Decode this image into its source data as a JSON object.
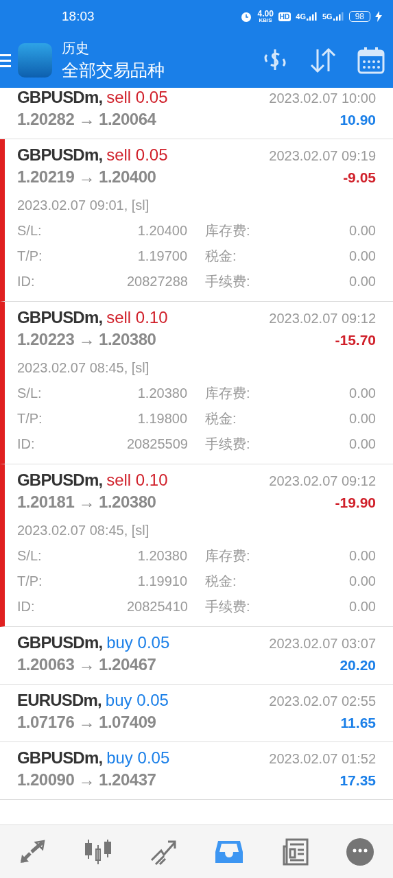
{
  "status_bar": {
    "time": "18:03",
    "speed": "4.00",
    "speed_unit": "KB/S",
    "hd": "HD",
    "net_1": "4G",
    "net_2": "5G",
    "battery": "98"
  },
  "header": {
    "title": "历史",
    "subtitle": "全部交易品种"
  },
  "trades": [
    {
      "symbol": "GBPUSDm,",
      "order": "sell 0.05",
      "kind": "sell",
      "prices": "1.20282 → 1.20064",
      "close_time": "2023.02.07 10:00",
      "profit": "10.90",
      "loss": false,
      "expanded": false
    },
    {
      "symbol": "GBPUSDm,",
      "order": "sell 0.05",
      "kind": "sell",
      "prices": "1.20219 → 1.20400",
      "close_time": "2023.02.07 09:19",
      "profit": "-9.05",
      "loss": true,
      "expanded": true,
      "open_time": "2023.02.07 09:01, [sl]",
      "details": [
        {
          "label": "S/L:",
          "value": "1.20400",
          "label_2": "库存费:",
          "value_2": "0.00"
        },
        {
          "label": "T/P:",
          "value": "1.19700",
          "label_2": "税金:",
          "value_2": "0.00"
        },
        {
          "label": "ID:",
          "value": "20827288",
          "label_2": "手续费:",
          "value_2": "0.00"
        }
      ]
    },
    {
      "symbol": "GBPUSDm,",
      "order": "sell 0.10",
      "kind": "sell",
      "prices": "1.20223 → 1.20380",
      "close_time": "2023.02.07 09:12",
      "profit": "-15.70",
      "loss": true,
      "expanded": true,
      "open_time": "2023.02.07 08:45, [sl]",
      "details": [
        {
          "label": "S/L:",
          "value": "1.20380",
          "label_2": "库存费:",
          "value_2": "0.00"
        },
        {
          "label": "T/P:",
          "value": "1.19800",
          "label_2": "税金:",
          "value_2": "0.00"
        },
        {
          "label": "ID:",
          "value": "20825509",
          "label_2": "手续费:",
          "value_2": "0.00"
        }
      ]
    },
    {
      "symbol": "GBPUSDm,",
      "order": "sell 0.10",
      "kind": "sell",
      "prices": "1.20181 → 1.20380",
      "close_time": "2023.02.07 09:12",
      "profit": "-19.90",
      "loss": true,
      "expanded": true,
      "open_time": "2023.02.07 08:45, [sl]",
      "details": [
        {
          "label": "S/L:",
          "value": "1.20380",
          "label_2": "库存费:",
          "value_2": "0.00"
        },
        {
          "label": "T/P:",
          "value": "1.19910",
          "label_2": "税金:",
          "value_2": "0.00"
        },
        {
          "label": "ID:",
          "value": "20825410",
          "label_2": "手续费:",
          "value_2": "0.00"
        }
      ]
    },
    {
      "symbol": "GBPUSDm,",
      "order": "buy 0.05",
      "kind": "buy",
      "prices": "1.20063 → 1.20467",
      "close_time": "2023.02.07 03:07",
      "profit": "20.20",
      "loss": false,
      "expanded": false
    },
    {
      "symbol": "EURUSDm,",
      "order": "buy 0.05",
      "kind": "buy",
      "prices": "1.07176 → 1.07409",
      "close_time": "2023.02.07 02:55",
      "profit": "11.65",
      "loss": false,
      "expanded": false
    },
    {
      "symbol": "GBPUSDm,",
      "order": "buy 0.05",
      "kind": "buy",
      "prices": "1.20090 → 1.20437",
      "close_time": "2023.02.07 01:52",
      "profit": "17.35",
      "loss": false,
      "expanded": false
    }
  ],
  "nav": [
    {
      "kind": "quotes",
      "selected": false
    },
    {
      "kind": "chart",
      "selected": false
    },
    {
      "kind": "trade",
      "selected": false
    },
    {
      "kind": "history",
      "selected": true
    },
    {
      "kind": "news",
      "selected": false
    },
    {
      "kind": "chat",
      "selected": false
    }
  ]
}
